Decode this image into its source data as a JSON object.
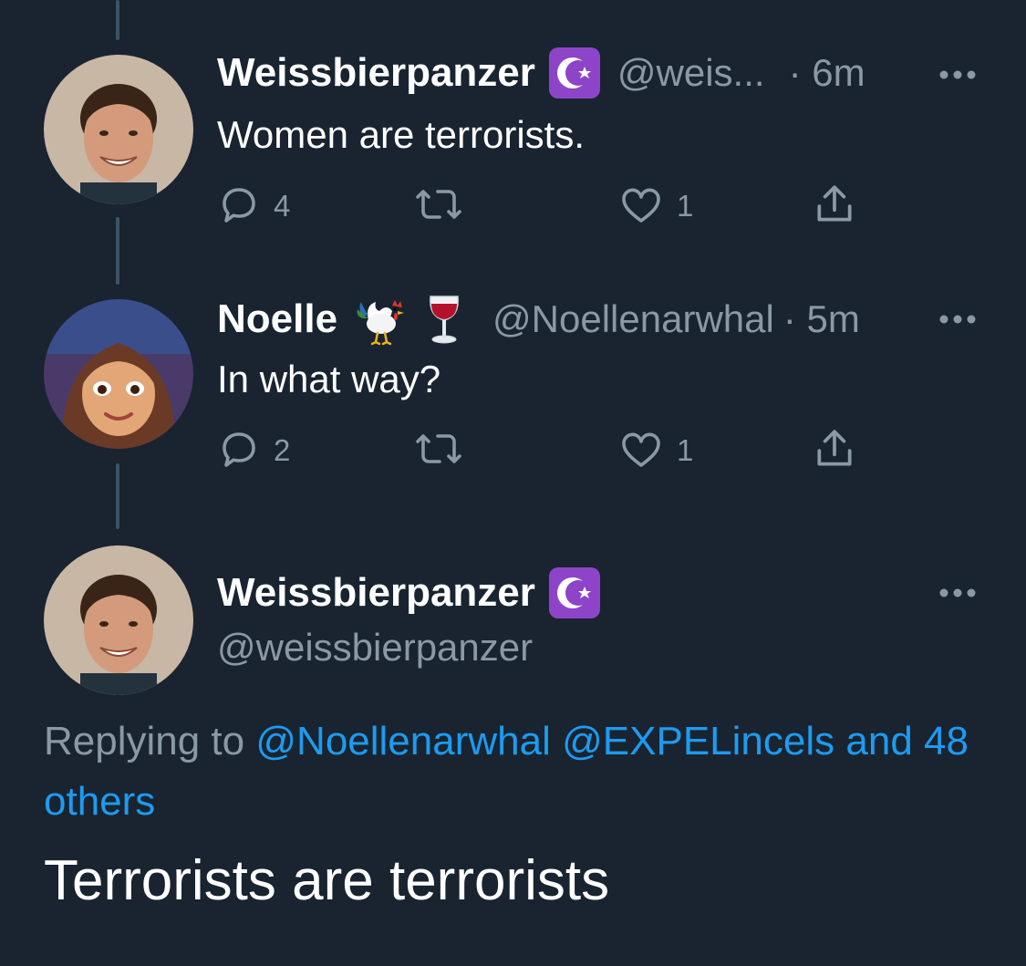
{
  "tweets": [
    {
      "display_name": "Weissbierpanzer",
      "badge_icon": "star-and-crescent-icon",
      "handle": "@weis...",
      "time": "· 6m",
      "text": "Women are terrorists.",
      "reply_count": "4",
      "like_count": "1"
    },
    {
      "display_name": "Noelle",
      "emojis": [
        "rooster-icon",
        "wine-glass-icon"
      ],
      "handle": "@Noellenarwhal",
      "time": "· 5m",
      "text": "In what way?",
      "reply_count": "2",
      "like_count": "1"
    }
  ],
  "focused": {
    "display_name": "Weissbierpanzer",
    "badge_icon": "star-and-crescent-icon",
    "handle": "@weissbierpanzer",
    "replying_prefix": "Replying to",
    "replying_mention_1": "@Noellenarwhal",
    "replying_mention_2": "@EXPELincels",
    "replying_and_others": "and",
    "replying_others": "48 others",
    "text": "Terrorists are terrorists"
  },
  "colors": {
    "background": "#192430",
    "text": "#ffffff",
    "secondary": "#8b98a5",
    "link": "#1d9bf0",
    "badge": "#8e44c9"
  }
}
